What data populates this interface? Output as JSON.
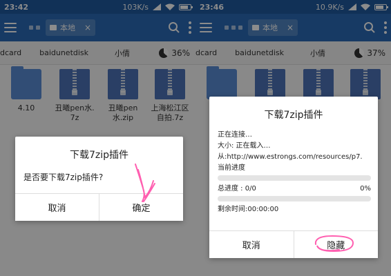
{
  "colors": {
    "statusbar": "#1f5a9e",
    "toolbar": "#2b6bb6",
    "folder": "#5a8dd6",
    "zip": "#4e73b8",
    "ink": "#ff5fb0"
  },
  "screens": [
    {
      "time": "23:42",
      "net_speed": "103K/s",
      "tab_label": "本地",
      "crumbs": [
        "dcard",
        "baidunetdisk",
        "小倩"
      ],
      "usage_pct": "36%",
      "usage_value": 0.36,
      "files": [
        {
          "name": "4.10",
          "icon": "folder-icon"
        },
        {
          "name": "丑曦pen水.\n7z",
          "icon": "zip-icon"
        },
        {
          "name": "丑曦pen\n水.zip",
          "icon": "zip-icon"
        },
        {
          "name": "上海松江区\n自拍.7z",
          "icon": "zip-icon"
        }
      ],
      "dialog": {
        "title": "下载7zip插件",
        "message": "是否要下载7zip插件?",
        "cancel": "取消",
        "confirm": "确定"
      }
    },
    {
      "time": "23:46",
      "net_speed": "10.9K/s",
      "tab_label": "本地",
      "crumbs": [
        "dcard",
        "baidunetdisk",
        "小倩"
      ],
      "usage_pct": "37%",
      "usage_value": 0.37,
      "files": [
        {
          "name": "",
          "icon": "folder-icon"
        },
        {
          "name": "",
          "icon": "zip-icon"
        },
        {
          "name": "",
          "icon": "zip-icon"
        },
        {
          "name": "",
          "icon": "zip-icon"
        }
      ],
      "dialog": {
        "title": "下载7zip插件",
        "connecting": "正在连接…",
        "size": "大小: 正在载入…",
        "from": "从:http://www.estrongs.com/resources/p7.",
        "current_progress": "当前进度",
        "total_progress": "总进度 : 0/0",
        "total_pct": "0%",
        "progress_value": 0,
        "remaining": "剩余时间:00:00:00",
        "cancel": "取消",
        "hide": "隐藏"
      }
    }
  ]
}
